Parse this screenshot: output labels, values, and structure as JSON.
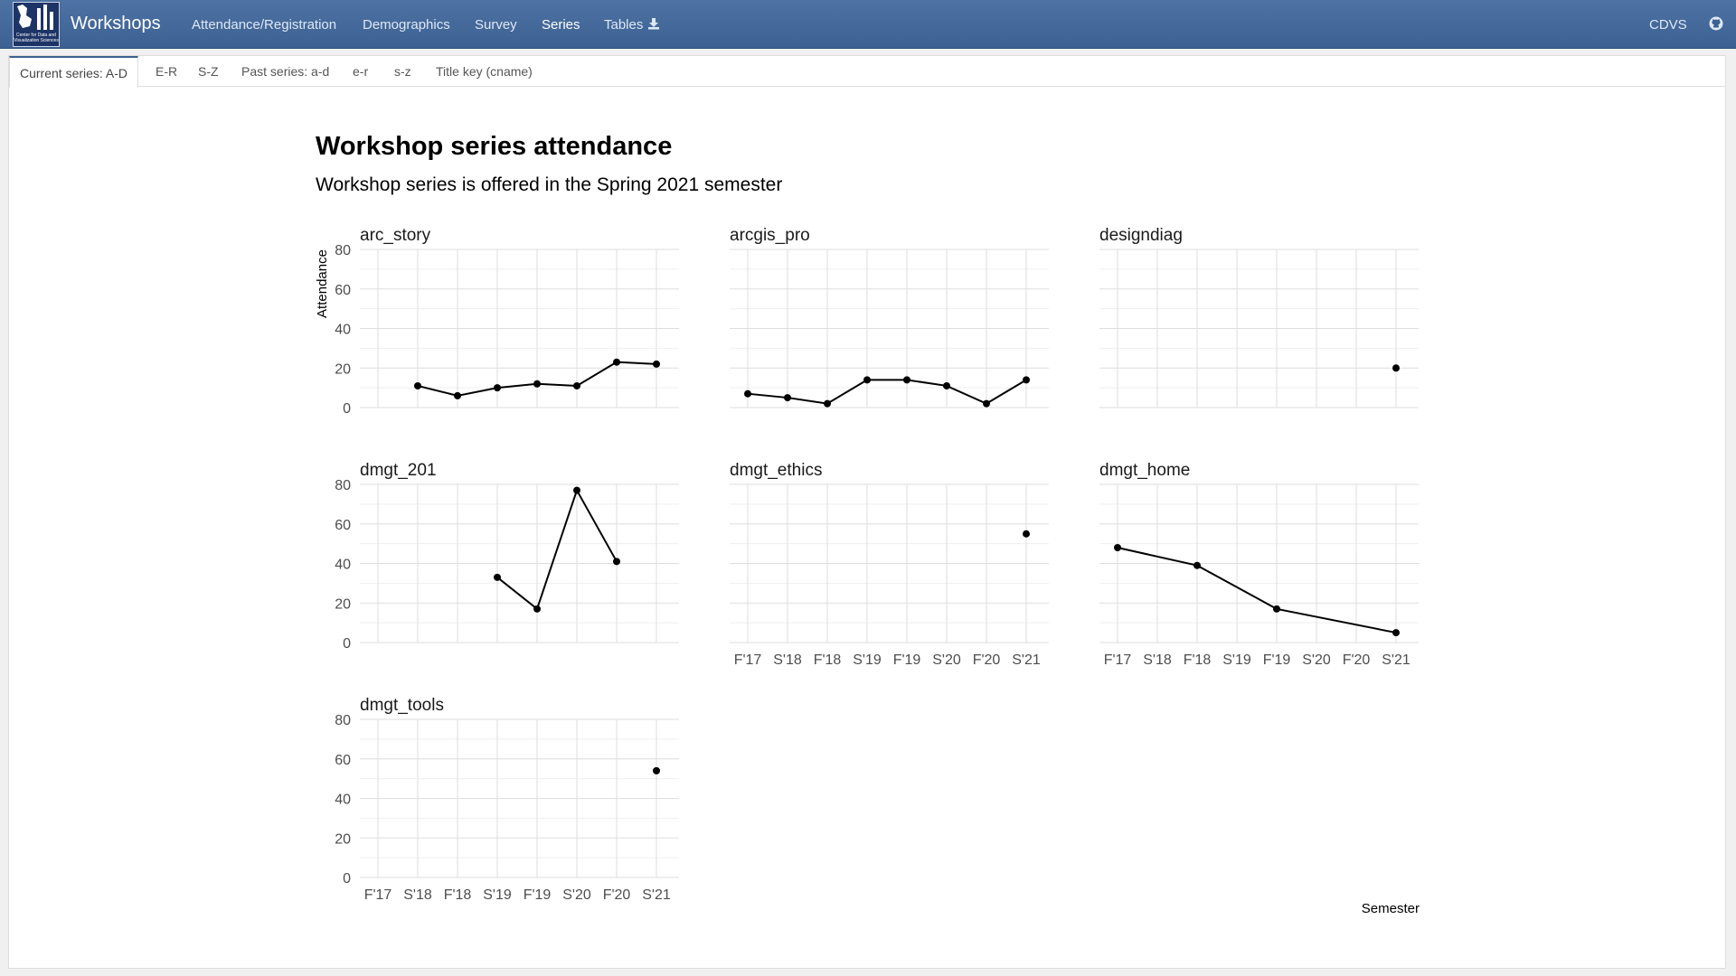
{
  "navbar": {
    "brand": "Workshops",
    "items": [
      "Attendance/Registration",
      "Demographics",
      "Survey",
      "Series",
      "Tables"
    ],
    "active": "Series",
    "right_link": "CDVS",
    "logo_lines": [
      "Center for Data and",
      "Visualization Sciences"
    ]
  },
  "tabs": {
    "items": [
      "Current series: A-D",
      "E-R",
      "S-Z",
      "Past series: a-d",
      "e-r",
      "s-z",
      "Title key (cname)"
    ],
    "active": "Current series: A-D"
  },
  "chart_data": {
    "type": "line",
    "title": "Workshop series attendance",
    "subtitle": "Workshop series is offered in the Spring 2021 semester",
    "xlabel": "Semester",
    "ylabel": "Attendance",
    "categories": [
      "F'17",
      "S'18",
      "F'18",
      "S'19",
      "F'19",
      "S'20",
      "F'20",
      "S'21"
    ],
    "ylim": [
      0,
      80
    ],
    "yticks": [
      0,
      20,
      40,
      60,
      80
    ],
    "grid": true,
    "panels": [
      {
        "name": "arc_story",
        "values": [
          null,
          11,
          6,
          10,
          12,
          11,
          23,
          22
        ]
      },
      {
        "name": "arcgis_pro",
        "values": [
          7,
          5,
          2,
          14,
          14,
          11,
          2,
          14
        ]
      },
      {
        "name": "designdiag",
        "values": [
          null,
          null,
          null,
          null,
          null,
          null,
          null,
          20
        ]
      },
      {
        "name": "dmgt_201",
        "values": [
          null,
          null,
          null,
          33,
          17,
          77,
          41,
          null
        ]
      },
      {
        "name": "dmgt_ethics",
        "values": [
          null,
          null,
          null,
          null,
          null,
          null,
          null,
          55
        ]
      },
      {
        "name": "dmgt_home",
        "values": [
          48,
          null,
          39,
          null,
          17,
          null,
          null,
          5
        ]
      },
      {
        "name": "dmgt_tools",
        "values": [
          null,
          null,
          null,
          null,
          null,
          null,
          null,
          54
        ]
      }
    ]
  }
}
